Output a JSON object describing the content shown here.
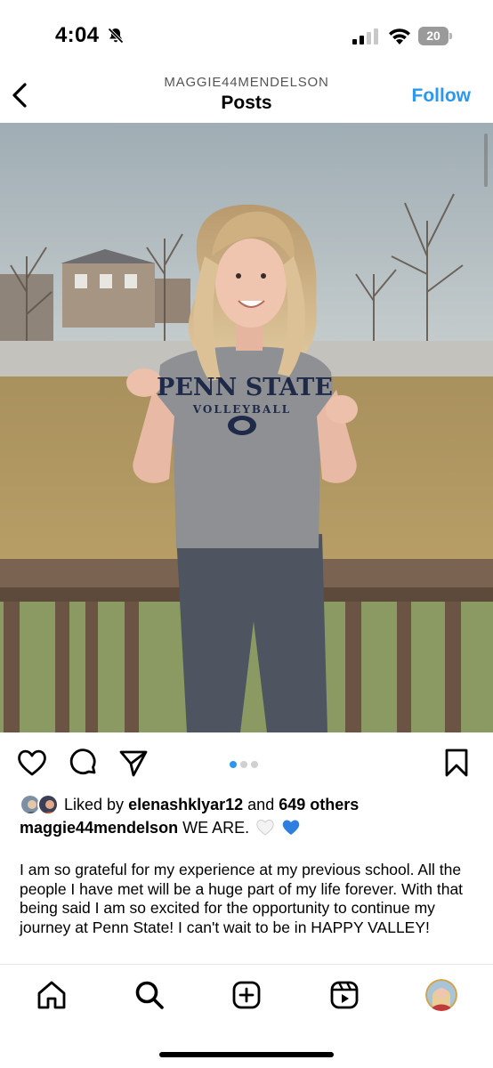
{
  "status_bar": {
    "time": "4:04",
    "battery": "20",
    "icons": [
      "bell-slash-icon",
      "cellular-signal-icon",
      "wifi-icon",
      "battery-icon"
    ]
  },
  "header": {
    "username": "MAGGIE44MENDELSON",
    "title": "Posts",
    "follow_label": "Follow",
    "accent_color": "#2a98f0"
  },
  "post": {
    "photo": {
      "shirt_line1": "PENN STATE",
      "shirt_line2": "VOLLEYBALL"
    },
    "carousel": {
      "count": 3,
      "active_index": 0
    },
    "actions": [
      "heart-icon",
      "comment-icon",
      "share-icon",
      "bookmark-icon"
    ],
    "likes": {
      "prefix": "Liked by",
      "user": "elenashklyar12",
      "and": "and",
      "others": "649 others"
    },
    "caption": {
      "user": "maggie44mendelson",
      "text": "WE ARE.",
      "emojis": [
        "white-heart",
        "blue-heart"
      ],
      "body": "I am so grateful for my experience at my previous school. All the people I have met will be a huge part of my life forever. With that being said I am so excited for the opportunity to continue my journey at Penn State! I can't wait to be in HAPPY VALLEY!"
    }
  },
  "tab_bar": {
    "tabs": [
      "home-icon",
      "search-icon",
      "create-icon",
      "reels-icon",
      "profile-avatar"
    ]
  }
}
